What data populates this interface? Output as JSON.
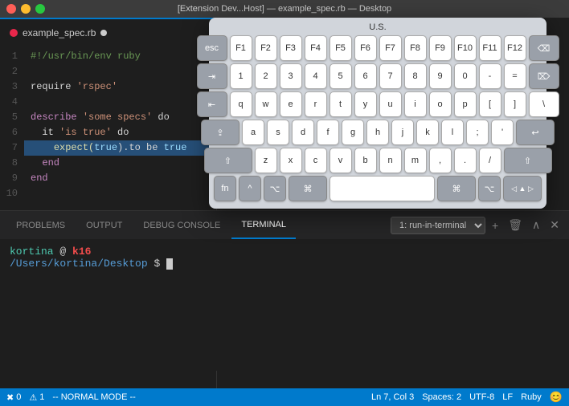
{
  "titleBar": {
    "text": "[Extension Dev...Host] — example_spec.rb — Desktop",
    "subtitle": "U.S."
  },
  "editor": {
    "tab": {
      "name": "example_spec.rb",
      "modified": false
    },
    "lines": [
      {
        "num": 1,
        "tokens": [
          {
            "text": "#!/usr/bin/env ruby",
            "class": "c-comment"
          }
        ]
      },
      {
        "num": 2,
        "tokens": []
      },
      {
        "num": 3,
        "tokens": [
          {
            "text": "require ",
            "class": "c-white"
          },
          {
            "text": "'rspec'",
            "class": "c-orange"
          }
        ]
      },
      {
        "num": 4,
        "tokens": []
      },
      {
        "num": 5,
        "tokens": [
          {
            "text": "describe ",
            "class": "c-keyword"
          },
          {
            "text": "'some specs'",
            "class": "c-orange"
          },
          {
            "text": " do",
            "class": "c-white"
          }
        ]
      },
      {
        "num": 6,
        "tokens": [
          {
            "text": "  it ",
            "class": "c-white"
          },
          {
            "text": "'is true'",
            "class": "c-orange"
          },
          {
            "text": " do",
            "class": "c-white"
          }
        ]
      },
      {
        "num": 7,
        "tokens": [
          {
            "text": "    ",
            "class": "c-white"
          },
          {
            "text": "expect(",
            "class": "c-method"
          },
          {
            "text": "true",
            "class": "c-blue"
          },
          {
            "text": ").to be ",
            "class": "c-white"
          },
          {
            "text": "true",
            "class": "c-blue"
          }
        ],
        "highlight": true
      },
      {
        "num": 8,
        "tokens": [
          {
            "text": "  end",
            "class": "c-keyword"
          }
        ]
      },
      {
        "num": 9,
        "tokens": [
          {
            "text": "end",
            "class": "c-keyword"
          }
        ]
      },
      {
        "num": 10,
        "tokens": []
      }
    ]
  },
  "keyboard": {
    "title": "U.S.",
    "rows": [
      {
        "keys": [
          {
            "label": "esc",
            "size": "w15",
            "dark": true
          },
          {
            "label": "F1",
            "size": "w1"
          },
          {
            "label": "F2",
            "size": "w1"
          },
          {
            "label": "F3",
            "size": "w1"
          },
          {
            "label": "F4",
            "size": "w1"
          },
          {
            "label": "F5",
            "size": "w1"
          },
          {
            "label": "F6",
            "size": "w1"
          },
          {
            "label": "F7",
            "size": "w1"
          },
          {
            "label": "F8",
            "size": "w1"
          },
          {
            "label": "F9",
            "size": "w1"
          },
          {
            "label": "F10",
            "size": "w1"
          },
          {
            "label": "F11",
            "size": "w1"
          },
          {
            "label": "F12",
            "size": "w1"
          },
          {
            "label": "⌫",
            "size": "w15",
            "dark": true
          }
        ]
      },
      {
        "keys": [
          {
            "label": "⇥",
            "size": "w15",
            "dark": true
          },
          {
            "label": "1",
            "size": "w1"
          },
          {
            "label": "2",
            "size": "w1"
          },
          {
            "label": "3",
            "size": "w1"
          },
          {
            "label": "4",
            "size": "w1"
          },
          {
            "label": "5",
            "size": "w1"
          },
          {
            "label": "6",
            "size": "w1"
          },
          {
            "label": "7",
            "size": "w1"
          },
          {
            "label": "8",
            "size": "w1"
          },
          {
            "label": "9",
            "size": "w1"
          },
          {
            "label": "0",
            "size": "w1"
          },
          {
            "label": "-",
            "size": "w1"
          },
          {
            "label": "=",
            "size": "w1"
          },
          {
            "label": "⌦",
            "size": "w15",
            "dark": true
          }
        ]
      },
      {
        "keys": [
          {
            "label": "⇤",
            "size": "w15",
            "dark": true
          },
          {
            "label": "q",
            "size": "w1"
          },
          {
            "label": "w",
            "size": "w1"
          },
          {
            "label": "e",
            "size": "w1"
          },
          {
            "label": "r",
            "size": "w1"
          },
          {
            "label": "t",
            "size": "w1"
          },
          {
            "label": "y",
            "size": "w1"
          },
          {
            "label": "u",
            "size": "w1"
          },
          {
            "label": "i",
            "size": "w1"
          },
          {
            "label": "o",
            "size": "w1"
          },
          {
            "label": "p",
            "size": "w1"
          },
          {
            "label": "[",
            "size": "w1"
          },
          {
            "label": "]",
            "size": "w1"
          },
          {
            "label": "\\",
            "size": "w15"
          }
        ]
      },
      {
        "keys": [
          {
            "label": "⇪",
            "size": "w2",
            "dark": true
          },
          {
            "label": "a",
            "size": "w1"
          },
          {
            "label": "s",
            "size": "w1"
          },
          {
            "label": "d",
            "size": "w1"
          },
          {
            "label": "f",
            "size": "w1"
          },
          {
            "label": "g",
            "size": "w1"
          },
          {
            "label": "h",
            "size": "w1"
          },
          {
            "label": "j",
            "size": "w1"
          },
          {
            "label": "k",
            "size": "w1"
          },
          {
            "label": "l",
            "size": "w1"
          },
          {
            "label": ";",
            "size": "w1"
          },
          {
            "label": "'",
            "size": "w1"
          },
          {
            "label": "↩",
            "size": "w2",
            "dark": true
          }
        ]
      },
      {
        "keys": [
          {
            "label": "⇧",
            "size": "w25",
            "dark": true
          },
          {
            "label": "z",
            "size": "w1"
          },
          {
            "label": "x",
            "size": "w1"
          },
          {
            "label": "c",
            "size": "w1"
          },
          {
            "label": "v",
            "size": "w1"
          },
          {
            "label": "b",
            "size": "w1"
          },
          {
            "label": "n",
            "size": "w1"
          },
          {
            "label": "m",
            "size": "w1"
          },
          {
            "label": ",",
            "size": "w1"
          },
          {
            "label": ".",
            "size": "w1"
          },
          {
            "label": "/",
            "size": "w1"
          },
          {
            "label": "⇧",
            "size": "w25",
            "dark": true
          }
        ]
      },
      {
        "keys": [
          {
            "label": "fn",
            "size": "w1",
            "dark": true
          },
          {
            "label": "^",
            "size": "w1",
            "dark": true
          },
          {
            "label": "⌥",
            "size": "w1",
            "dark": true
          },
          {
            "label": "⌘",
            "size": "w2",
            "dark": true
          },
          {
            "label": "",
            "size": "space"
          },
          {
            "label": "⌘",
            "size": "w2",
            "dark": true
          },
          {
            "label": "⌥",
            "size": "w1",
            "dark": true
          },
          {
            "label": "◁ ▲ ▷",
            "size": "w2",
            "dark": true
          }
        ]
      }
    ]
  },
  "bottomPanel": {
    "tabs": [
      {
        "label": "PROBLEMS",
        "active": false
      },
      {
        "label": "OUTPUT",
        "active": false
      },
      {
        "label": "DEBUG CONSOLE",
        "active": false
      },
      {
        "label": "TERMINAL",
        "active": true
      }
    ],
    "terminalSelect": "1: run-in-terminal",
    "terminal": {
      "user": "kortina",
      "at": "@",
      "host": "k16",
      "path": "/Users/kortina/Desktop",
      "prompt": "$"
    }
  },
  "statusBar": {
    "errors": "0",
    "warnings": "1",
    "mode": "-- NORMAL MODE --",
    "position": "Ln 7, Col 3",
    "spaces": "Spaces: 2",
    "encoding": "UTF-8",
    "lineEnding": "LF",
    "language": "Ruby",
    "icons": {
      "branch": "⎇",
      "error": "✖",
      "warning": "⚠",
      "smiley": "😊"
    }
  }
}
